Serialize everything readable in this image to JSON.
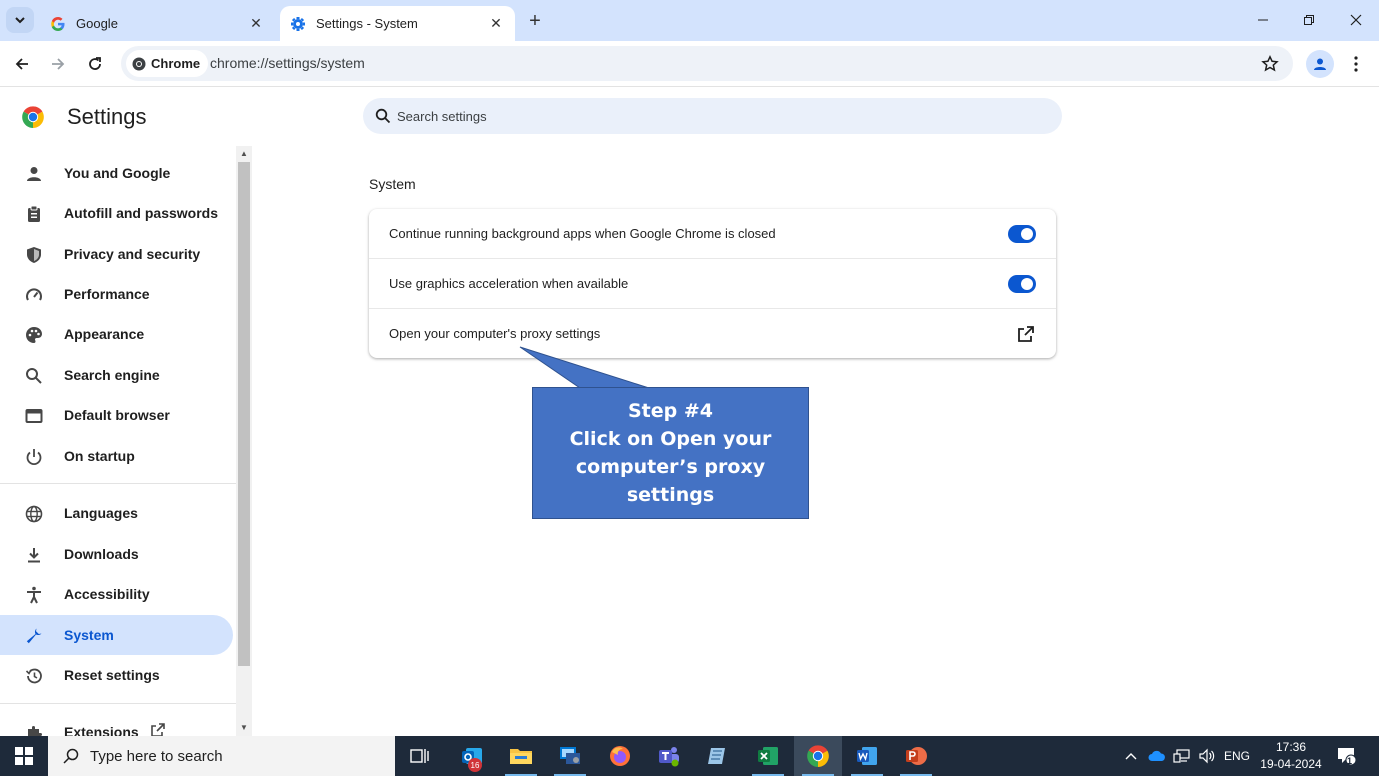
{
  "browser": {
    "tabs": [
      {
        "title": "Google",
        "active": false
      },
      {
        "title": "Settings - System",
        "active": true
      }
    ],
    "omnibox": {
      "chip_label": "Chrome",
      "url": "chrome://settings/system"
    }
  },
  "settings": {
    "title": "Settings",
    "search_placeholder": "Search settings",
    "sidebar": {
      "items": [
        {
          "label": "You and Google",
          "icon": "person-icon"
        },
        {
          "label": "Autofill and passwords",
          "icon": "clipboard-icon"
        },
        {
          "label": "Privacy and security",
          "icon": "shield-icon"
        },
        {
          "label": "Performance",
          "icon": "speedometer-icon"
        },
        {
          "label": "Appearance",
          "icon": "palette-icon"
        },
        {
          "label": "Search engine",
          "icon": "search-icon"
        },
        {
          "label": "Default browser",
          "icon": "browser-window-icon"
        },
        {
          "label": "On startup",
          "icon": "power-icon"
        },
        {
          "label": "Languages",
          "icon": "globe-icon"
        },
        {
          "label": "Downloads",
          "icon": "download-icon"
        },
        {
          "label": "Accessibility",
          "icon": "accessibility-icon"
        },
        {
          "label": "System",
          "icon": "wrench-icon",
          "selected": true
        },
        {
          "label": "Reset settings",
          "icon": "history-icon"
        },
        {
          "label": "Extensions",
          "icon": "puzzle-icon"
        }
      ]
    },
    "section_title": "System",
    "rows": [
      {
        "label": "Continue running background apps when Google Chrome is closed",
        "control": "toggle",
        "on": true
      },
      {
        "label": "Use graphics acceleration when available",
        "control": "toggle",
        "on": true
      },
      {
        "label": "Open your computer's proxy settings",
        "control": "external-link"
      }
    ]
  },
  "callout": {
    "line1": "Step #4",
    "line2": "Click on Open your",
    "line3": "computer’s proxy settings",
    "color": "#4472c4"
  },
  "taskbar": {
    "search_placeholder": "Type here to search",
    "outlook_badge": "16",
    "language": "ENG",
    "time": "17:36",
    "date": "19-04-2024",
    "notification_count": "1"
  },
  "colors": {
    "accent": "#0b57d0",
    "tabstrip": "#d3e3fd",
    "selected_nav": "#d3e3fd"
  }
}
